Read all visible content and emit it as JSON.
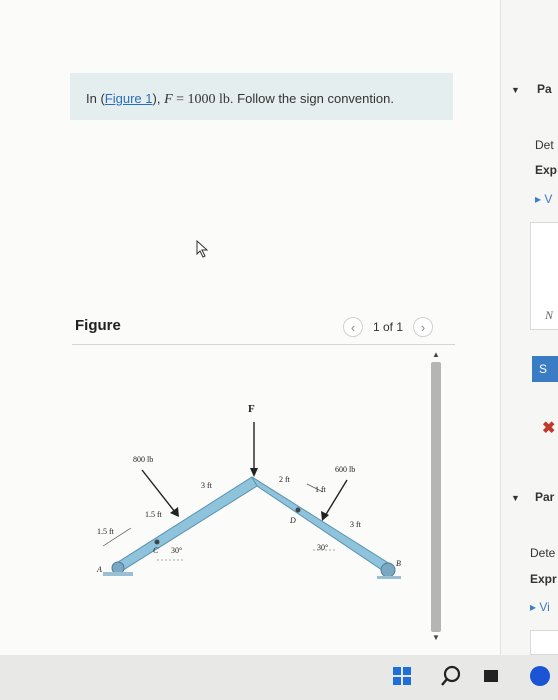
{
  "problem": {
    "prefix": "In (",
    "figure_link": "Figure 1",
    "suffix_after_link": "), ",
    "var": "F",
    "equals": " = 1000 lb",
    "instruction": ". Follow the sign convention."
  },
  "figure_header": {
    "title": "Figure",
    "pager_text": "1 of 1",
    "prev_glyph": "‹",
    "next_glyph": "›"
  },
  "diagram": {
    "labels": {
      "force_F": "F",
      "force_800": "800 lb",
      "force_600": "600 lb",
      "dim_15_left": "1.5 ft",
      "dim_15_top": "1.5 ft",
      "dim_3_left": "3 ft",
      "dim_2": "2 ft",
      "dim_1": "1 ft",
      "dim_3_right": "3 ft",
      "angle_left": "30°",
      "angle_right": "30°",
      "point_A": "A",
      "point_B": "B",
      "point_C": "C",
      "point_D": "D"
    },
    "colors": {
      "beam": "#8fc3dc",
      "beam_edge": "#5a93b0",
      "support": "#7aa8c2"
    }
  },
  "right_panel": {
    "part_a": "Pa",
    "det_a": "Det",
    "exp_a": "Exp",
    "v_a": "V",
    "n_val": "N",
    "submit": "S",
    "part_b": "Par",
    "det_b": "Dete",
    "exp_b": "Expr",
    "v_b": "Vi"
  }
}
